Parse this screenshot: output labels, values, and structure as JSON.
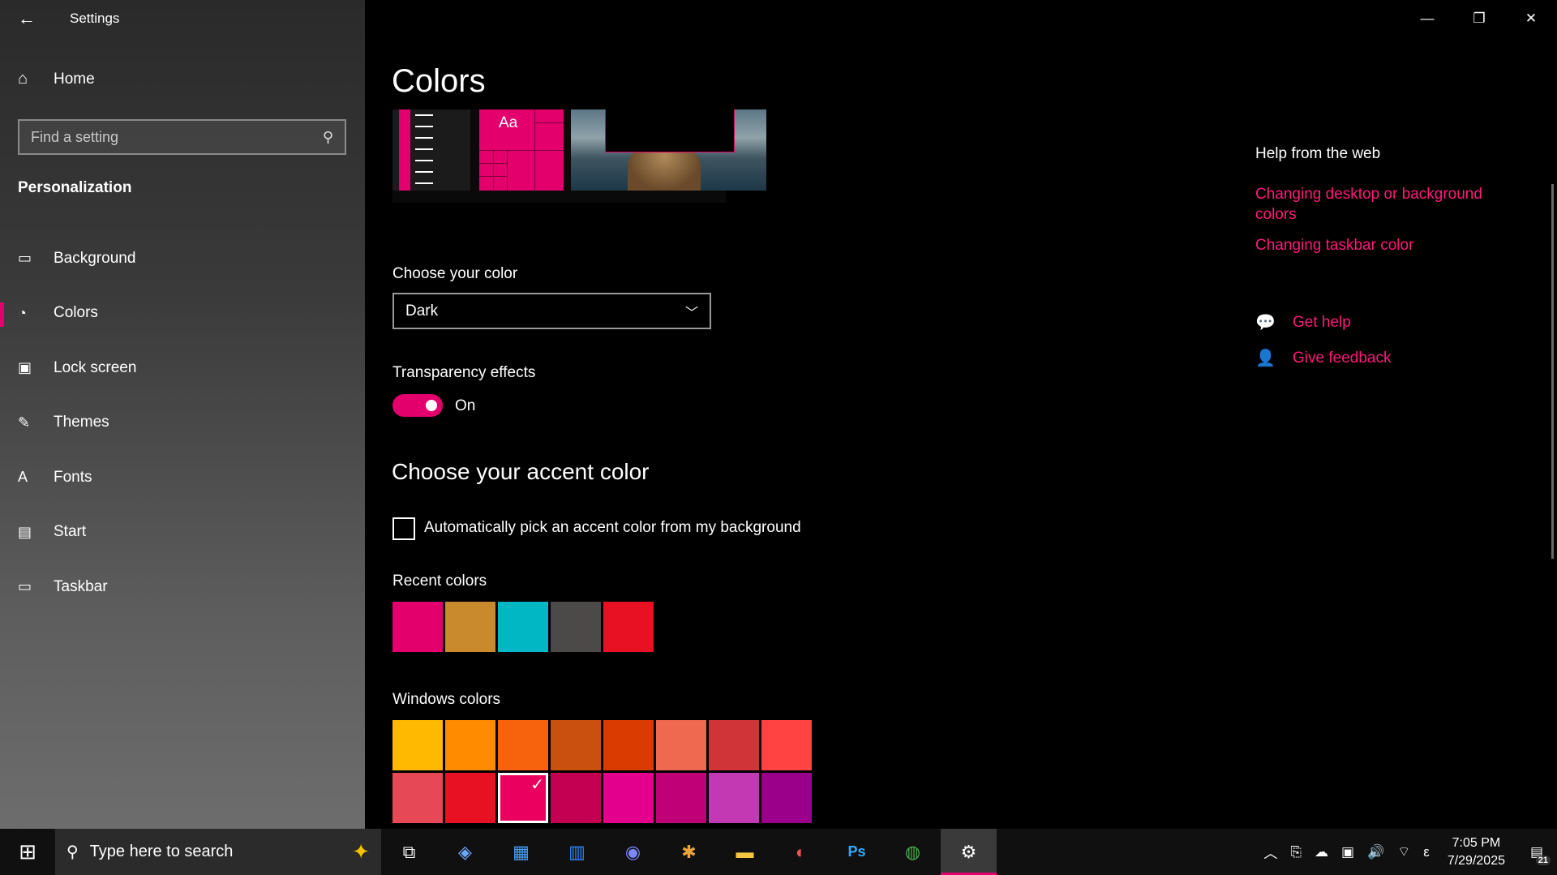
{
  "app": {
    "title": "Settings"
  },
  "sidebar": {
    "home": "Home",
    "search_placeholder": "Find a setting",
    "section": "Personalization",
    "items": [
      {
        "label": "Background",
        "icon": "image-icon"
      },
      {
        "label": "Colors",
        "icon": "palette-icon",
        "active": true
      },
      {
        "label": "Lock screen",
        "icon": "lock-screen-icon"
      },
      {
        "label": "Themes",
        "icon": "brush-icon"
      },
      {
        "label": "Fonts",
        "icon": "font-icon"
      },
      {
        "label": "Start",
        "icon": "start-icon"
      },
      {
        "label": "Taskbar",
        "icon": "taskbar-icon"
      }
    ]
  },
  "main": {
    "title": "Colors",
    "preview_label": "Aa",
    "choose_color_label": "Choose your color",
    "choose_color_value": "Dark",
    "transparency_label": "Transparency effects",
    "transparency_state": "On",
    "accent_heading": "Choose your accent color",
    "auto_pick_label": "Automatically pick an accent color from my background",
    "recent_colors_label": "Recent colors",
    "recent_colors": [
      "#e3006d",
      "#c9892d",
      "#00b7c3",
      "#4c4a48",
      "#e81123"
    ],
    "windows_colors_label": "Windows colors",
    "windows_colors": [
      "#ffb900",
      "#ff8c00",
      "#f7630c",
      "#ca5010",
      "#da3b01",
      "#ef6950",
      "#d13438",
      "#ff4343",
      "#e74856",
      "#e81123",
      "#ea005e",
      "#c30052",
      "#e3008c",
      "#bf0077",
      "#c239b3",
      "#9a0089"
    ],
    "selected_color_index": 10
  },
  "help": {
    "title": "Help from the web",
    "links": [
      "Changing desktop or background colors",
      "Changing taskbar color"
    ],
    "get_help": "Get help",
    "give_feedback": "Give feedback"
  },
  "taskbar": {
    "search_placeholder": "Type here to search",
    "time": "7:05 PM",
    "date": "7/29/2025",
    "notification_count": "21",
    "lang": "ε"
  },
  "colors": {
    "accent": "#e3006d",
    "link": "#ff1a7a"
  }
}
